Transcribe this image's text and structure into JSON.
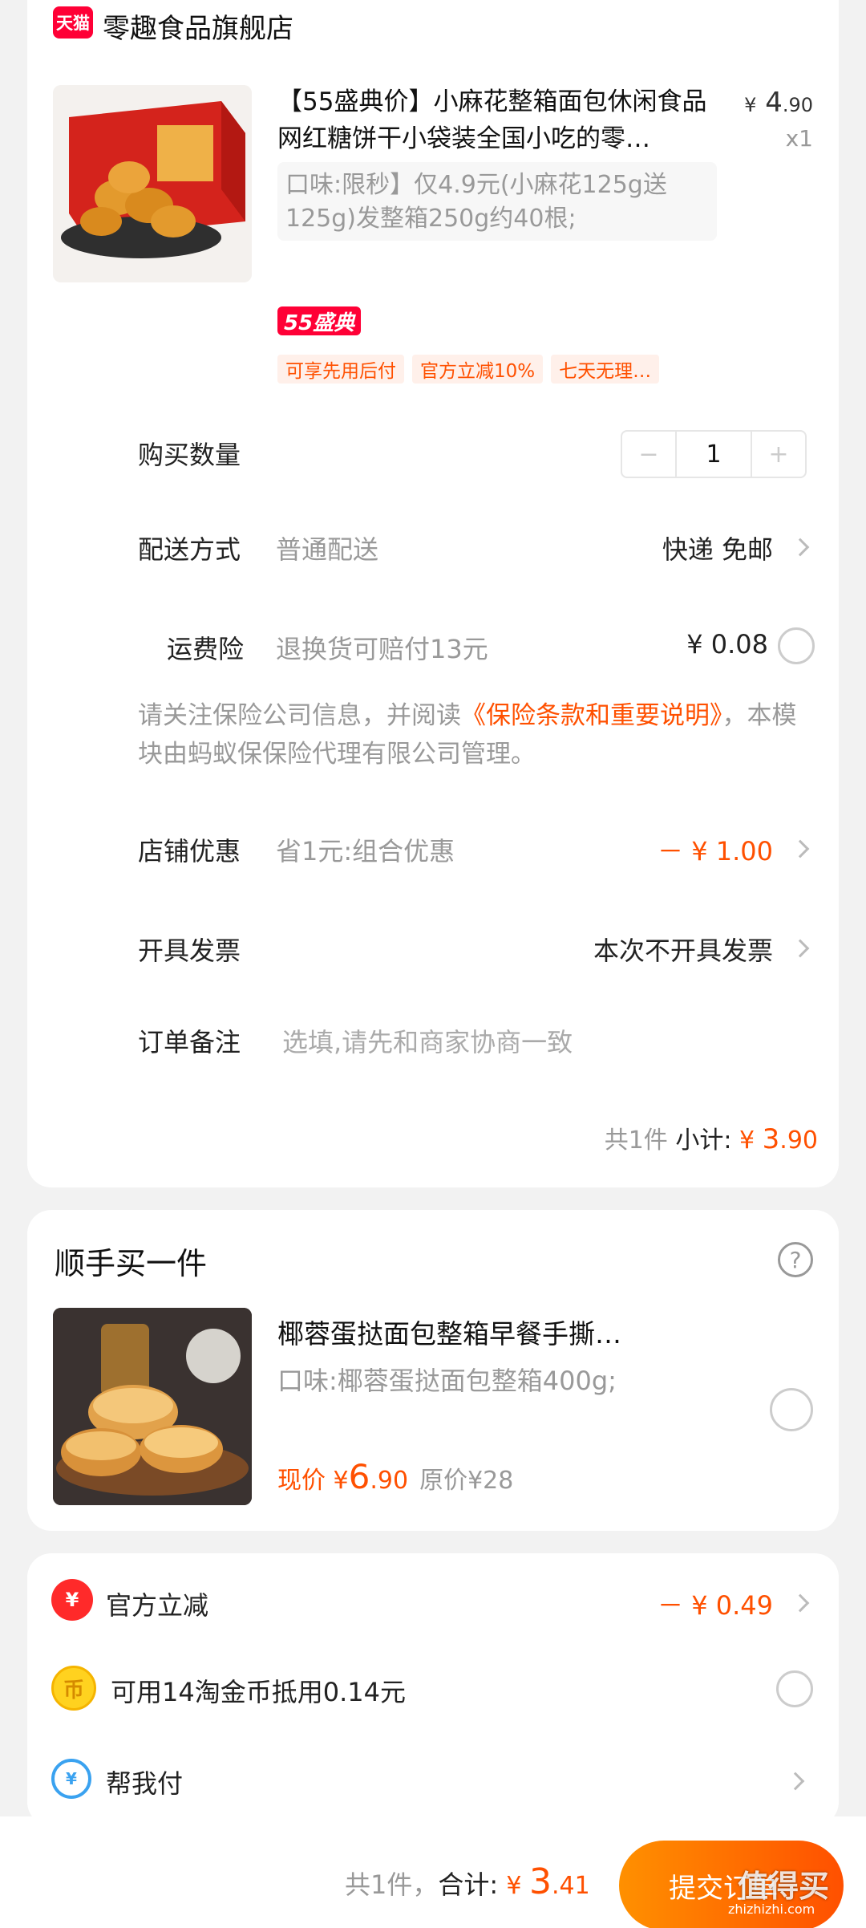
{
  "store": {
    "badge": "天猫",
    "name": "零趣食品旗舰店"
  },
  "product": {
    "title": "【55盛典价】小麻花整箱面包休闲食品网红糖饼干小袋装全国小吃的零…",
    "price_symbol": "¥",
    "price_int": "4",
    "price_dec": ".90",
    "quantity_label": "x1",
    "sku": "口味:限秒】仅4.9元(小麻花125g送125g)发整箱250g约40根;",
    "promo_badge": "55盛典",
    "tags": [
      "可享先用后付",
      "官方立减10%",
      "七天无理…"
    ]
  },
  "quantity": {
    "label": "购买数量",
    "minus": "−",
    "value": "1",
    "plus": "+"
  },
  "delivery": {
    "label": "配送方式",
    "method": "普通配送",
    "value": "快递 免邮"
  },
  "insurance": {
    "label": "运费险",
    "desc": "退换货可赔付13元",
    "price": "¥ 0.08",
    "note_prefix": "请关注保险公司信息，并阅读",
    "note_link": "《保险条款和重要说明》",
    "note_suffix": "，本模块由蚂蚁保保险代理有限公司管理。"
  },
  "store_discount": {
    "label": "店铺优惠",
    "desc": "省1元:组合优惠",
    "value": "－ ¥ 1.00"
  },
  "invoice": {
    "label": "开具发票",
    "value": "本次不开具发票"
  },
  "remark": {
    "label": "订单备注",
    "placeholder": "选填,请先和商家协商一致"
  },
  "subtotal": {
    "count": "共1件",
    "label": "小计:",
    "symbol": "¥",
    "int": "3",
    "dec": ".90"
  },
  "addon": {
    "title": "顺手买一件",
    "help": "?",
    "name": "椰蓉蛋挞面包整箱早餐手撕…",
    "sku": "口味:椰蓉蛋挞面包整箱400g;",
    "price_label": "现价",
    "price_symbol": "¥",
    "price_int": "6",
    "price_dec": ".90",
    "orig_price": "原价¥28"
  },
  "discounts": {
    "official": {
      "icon_text": "¥",
      "label": "官方立减",
      "value": "－ ¥ 0.49"
    },
    "coins": {
      "icon_text": "币",
      "label": "可用14淘金币抵用0.14元"
    },
    "help_pay": {
      "icon_text": "¥",
      "label": "帮我付"
    }
  },
  "bottom": {
    "count": "共1件，",
    "total_label": "合计:",
    "symbol": "¥",
    "int": "3",
    "dec": ".41",
    "submit": "提交订单"
  },
  "watermark": {
    "text": "值得买",
    "url": "zhizhizhi.com"
  },
  "colors": {
    "accent": "#ff5000",
    "tmall_red": "#ff0036",
    "background": "#f2f2f2"
  }
}
